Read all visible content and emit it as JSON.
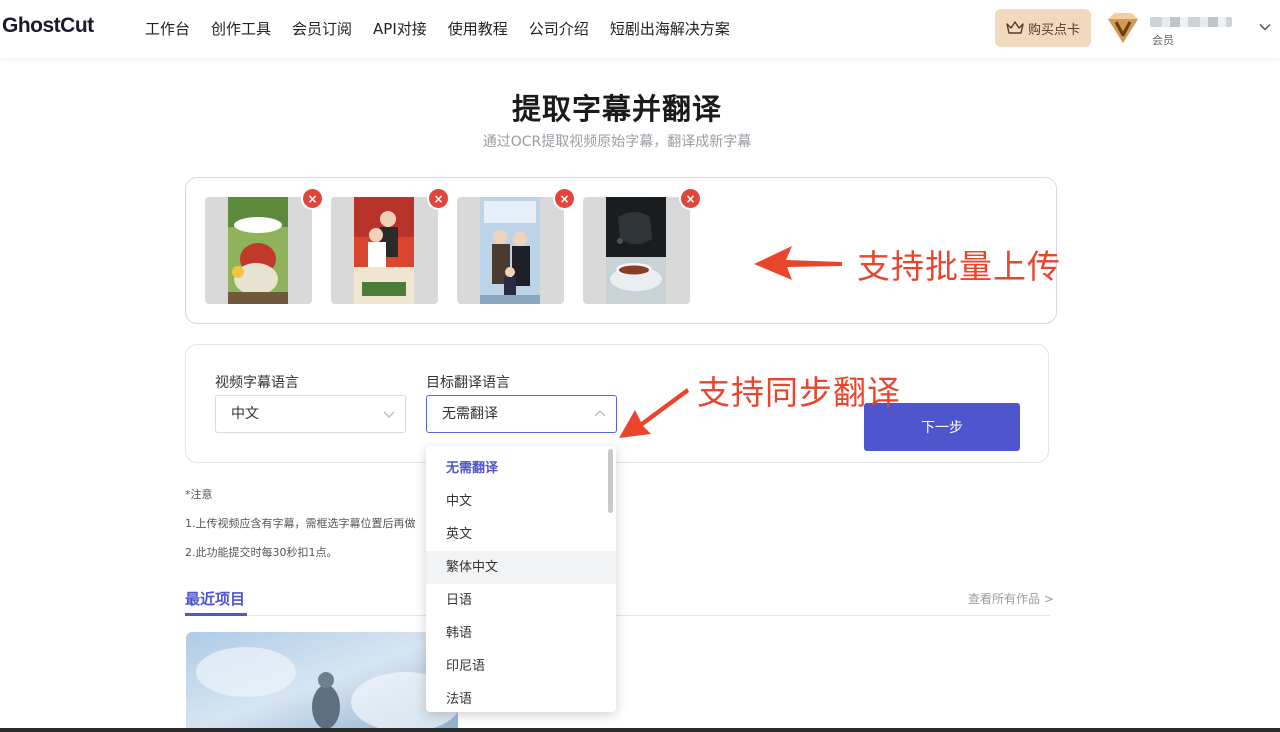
{
  "header": {
    "logo": "GhostCut",
    "nav": [
      "工作台",
      "创作工具",
      "会员订阅",
      "API对接",
      "使用教程",
      "公司介绍",
      "短剧出海解决方案"
    ],
    "buy_button": "购买点卡",
    "user_role": "会员"
  },
  "page": {
    "title": "提取字幕并翻译",
    "subtitle": "通过OCR提取视频原始字幕，翻译成新字幕"
  },
  "upload": {
    "thumbnail_count": 4,
    "close_label": "×",
    "annotation": "支持批量上传"
  },
  "settings": {
    "source_label": "视频字幕语言",
    "source_value": "中文",
    "target_label": "目标翻译语言",
    "target_value": "无需翻译",
    "annotation": "支持同步翻译",
    "next_button": "下一步"
  },
  "notes": {
    "heading": "*注意",
    "line1": "1.上传视频应含有字幕，需框选字幕位置后再做",
    "line2": "2.此功能提交时每30秒扣1点。"
  },
  "recent": {
    "tab": "最近项目",
    "view_all": "查看所有作品 >"
  },
  "dropdown": {
    "options": [
      "无需翻译",
      "中文",
      "英文",
      "繁体中文",
      "日语",
      "韩语",
      "印尼语",
      "法语"
    ],
    "selected_index": 0,
    "hovered_index": 3
  },
  "colors": {
    "accent": "#4f55cc",
    "annotation": "#e8452c",
    "close_badge": "#e2453c",
    "buy_button_bg": "#f1d9bf"
  }
}
